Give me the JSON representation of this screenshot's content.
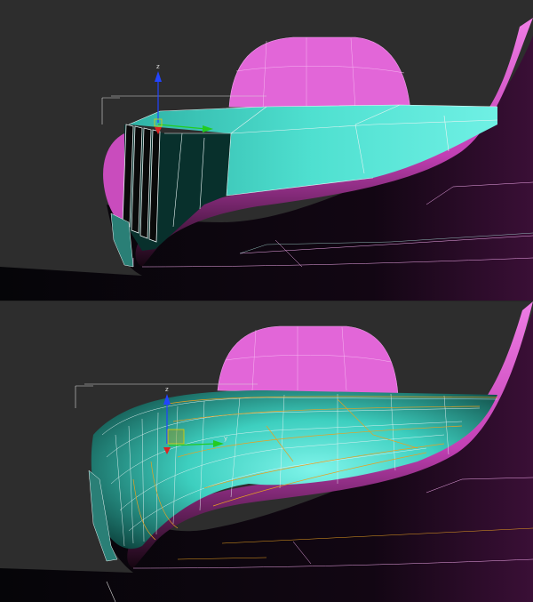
{
  "viewports": {
    "top": {
      "gizmo": {
        "z_label": "z",
        "y_label": "y"
      }
    },
    "bottom": {
      "gizmo": {
        "z_label": "z",
        "y_label": "y"
      }
    }
  },
  "colors": {
    "background": "#2d2d2d",
    "body_magenta": "#e05ad0",
    "body_highlight": "#f07ee6",
    "teal_surface": "#45d8c8",
    "teal_dark": "#0d3a36",
    "wire_white": "#e8f4f4",
    "wire_orange": "#e8a020",
    "gizmo_z": "#2244ff",
    "gizmo_y": "#22cc22",
    "gizmo_x": "#dd2222"
  }
}
